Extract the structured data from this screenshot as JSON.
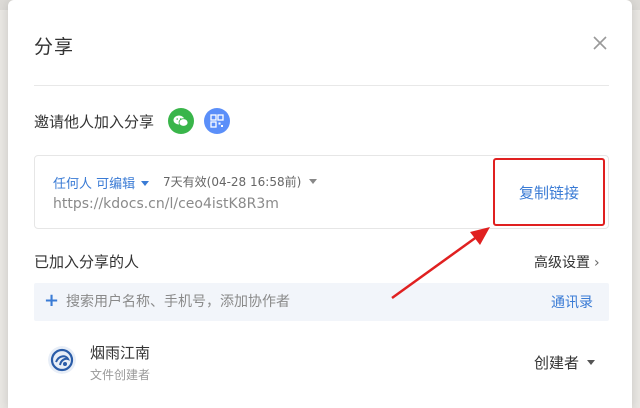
{
  "dialog": {
    "title": "分享",
    "invite_label": "邀请他人加入分享",
    "share_icons": [
      "wechat-icon",
      "qrcode-icon"
    ],
    "link": {
      "permission": "任何人 可编辑",
      "validity": "7天有效(04-28 16:58前)",
      "url": "https://kdocs.cn/l/ceo4istK8R3m",
      "copy_label": "复制链接"
    },
    "members_section": {
      "label": "已加入分享的人",
      "advanced_label": "高级设置",
      "search_placeholder": "搜索用户名称、手机号，添加协作者",
      "contacts_label": "通讯录"
    },
    "members": [
      {
        "name": "烟雨江南",
        "subtitle": "文件创建者",
        "role": "创建者"
      }
    ]
  },
  "colors": {
    "accent": "#3a7bd5",
    "highlight_red": "#e02020",
    "wechat_green": "#39b54a",
    "qrcode_blue": "#5b8ff9"
  }
}
